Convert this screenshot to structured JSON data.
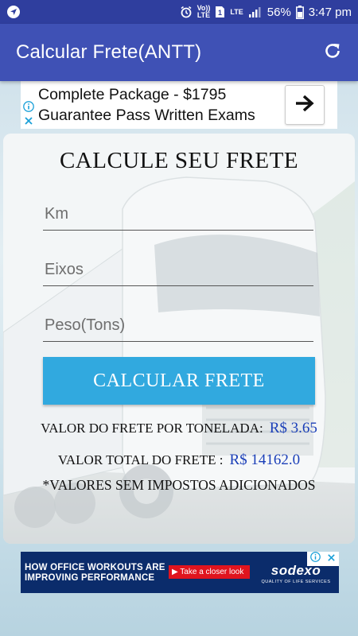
{
  "status_bar": {
    "volte_top": "Vo))",
    "volte_bottom": "LTE",
    "lte": "LTE",
    "battery_pct": "56%",
    "time": "3:47 pm"
  },
  "app_bar": {
    "title": "Calcular Frete(ANTT)"
  },
  "ad_top": {
    "line1": "Complete Package - $1795",
    "line2": "Guarantee Pass Written Exams"
  },
  "card": {
    "title": "CALCULE SEU FRETE",
    "km_placeholder": "Km",
    "eixos_placeholder": "Eixos",
    "peso_placeholder": "Peso(Tons)",
    "button_label": "CALCULAR FRETE",
    "per_ton_label": "VALOR DO FRETE POR TONELADA:",
    "per_ton_value": "R$ 3.65",
    "total_label": "VALOR TOTAL DO FRETE :",
    "total_value": "R$ 14162.0",
    "note": "*VALORES SEM IMPOSTOS ADICIONADOS"
  },
  "ad_bottom": {
    "line1": "HOW OFFICE WORKOUTS ARE",
    "line2": "IMPROVING PERFORMANCE",
    "cta": "▶ Take a closer look",
    "brand": "sodexo",
    "tagline": "QUALITY OF LIFE SERVICES"
  },
  "icons": {
    "navigation": "navigation-arrow-icon",
    "alarm": "alarm-icon",
    "sim": "sim-icon",
    "signal": "signal-icon",
    "battery": "battery-icon",
    "refresh": "refresh-icon",
    "ad_info": "info-icon",
    "ad_close": "close-icon",
    "ad_arrow": "arrow-right-icon"
  },
  "colors": {
    "status_bar": "#2f3e9e",
    "app_bar": "#3f51b5",
    "button": "#31a9df",
    "result_value": "#1b3fb8",
    "ad_bottom_bg": "#0b2c6b"
  }
}
